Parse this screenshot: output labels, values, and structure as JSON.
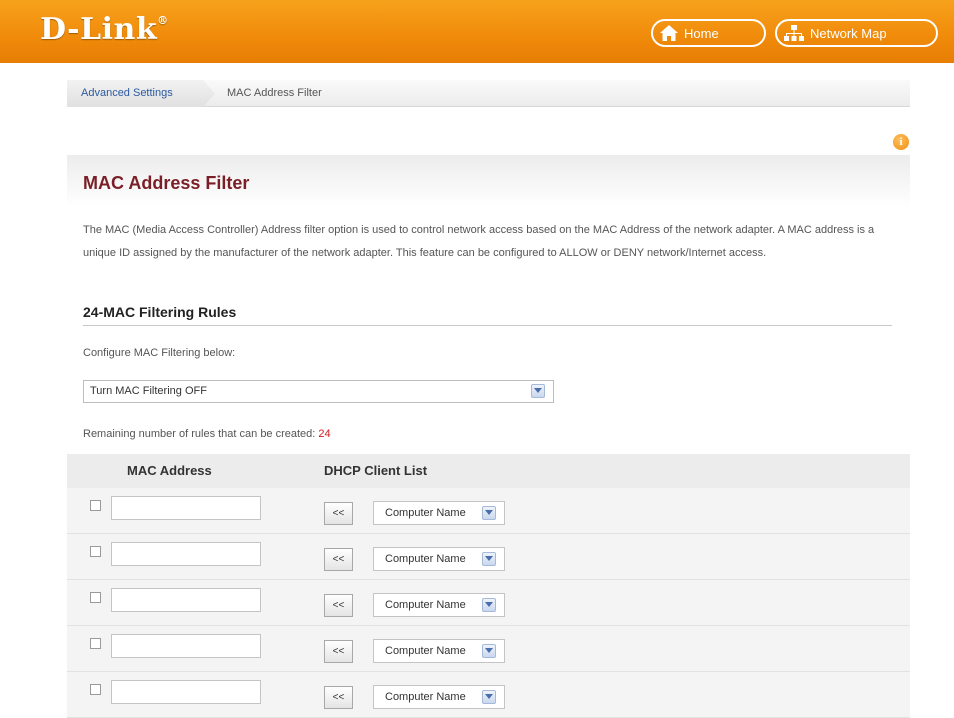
{
  "header": {
    "logo": "D-Link",
    "logo_mark": "®",
    "home_label": "Home",
    "network_map_label": "Network Map"
  },
  "breadcrumb": {
    "items": [
      "Advanced Settings",
      "MAC Address Filter"
    ]
  },
  "page": {
    "title": "MAC Address Filter",
    "description": "The MAC (Media Access Controller) Address filter option is used to control network access based on the MAC Address of the network adapter. A MAC address is a unique ID assigned by the manufacturer of the network adapter. This feature can be configured to ALLOW or DENY network/Internet access.",
    "section_title": "24-MAC Filtering Rules",
    "configure_label": "Configure MAC Filtering below:",
    "filter_mode": {
      "selected": "Turn MAC Filtering OFF"
    },
    "remaining_label": "Remaining number of rules that can be created:",
    "remaining_count": "24"
  },
  "table": {
    "headers": {
      "mac": "MAC Address",
      "dhcp": "DHCP Client List"
    },
    "rows": [
      {
        "checked": false,
        "mac": "",
        "copy_label": "<<",
        "client": "Computer Name"
      },
      {
        "checked": false,
        "mac": "",
        "copy_label": "<<",
        "client": "Computer Name"
      },
      {
        "checked": false,
        "mac": "",
        "copy_label": "<<",
        "client": "Computer Name"
      },
      {
        "checked": false,
        "mac": "",
        "copy_label": "<<",
        "client": "Computer Name"
      },
      {
        "checked": false,
        "mac": "",
        "copy_label": "<<",
        "client": "Computer Name"
      }
    ]
  },
  "colors": {
    "header_orange": "#f08a0a",
    "title_maroon": "#7a1f27",
    "breadcrumb_link": "#2c5aa0",
    "remaining_count": "#d01c1c"
  },
  "icons": [
    "home-icon",
    "network-map-icon",
    "info-icon",
    "dropdown-arrow-icon"
  ]
}
